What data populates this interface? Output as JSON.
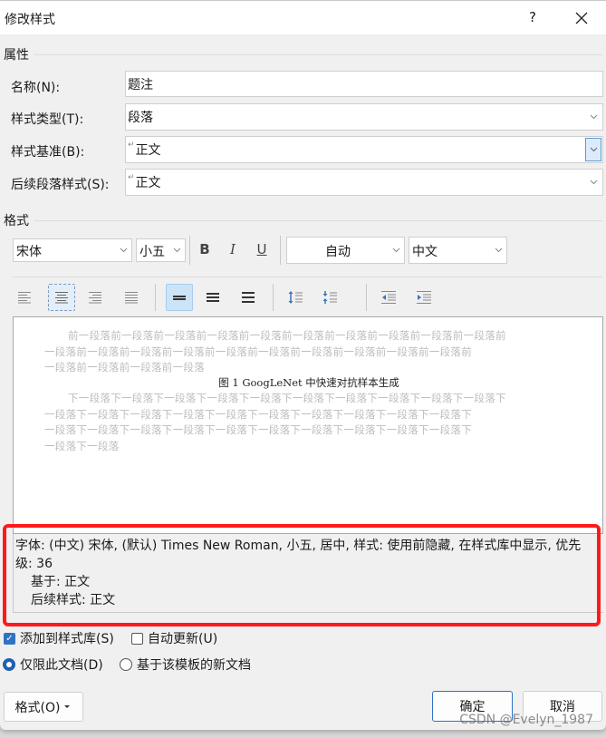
{
  "window": {
    "title": "修改样式",
    "help_label": "?",
    "close_label": "close"
  },
  "properties": {
    "section_label": "属性",
    "name": {
      "label": "名称(N):",
      "value": "题注"
    },
    "style_type": {
      "label": "样式类型(T):",
      "value": "段落"
    },
    "style_based_on": {
      "label": "样式基准(B):",
      "value": "正文",
      "para_mark": "↵"
    },
    "next_style": {
      "label": "后续段落样式(S):",
      "value": "正文",
      "para_mark": "↵"
    }
  },
  "format": {
    "section_label": "格式",
    "font": "宋体",
    "size": "小五",
    "bold_label": "B",
    "italic_label": "I",
    "underline_label": "U",
    "color": "自动",
    "script": "中文",
    "alignment_buttons": [
      "align-left",
      "align-center",
      "align-right",
      "align-justify"
    ],
    "selected_alignment": "align-center",
    "line_spacing_buttons": [
      "single",
      "one-and-half",
      "double"
    ],
    "selected_line_spacing": "single",
    "paragraph_spacing_buttons": [
      "increase-spacing",
      "decrease-spacing"
    ],
    "indent_buttons": [
      "decrease-indent",
      "increase-indent"
    ]
  },
  "preview": {
    "previous_lines": [
      "前一段落前一段落前一段落前一段落前一段落前一段落前一段落前一段落前一段落前一段落前",
      "一段落前一段落前一段落前一段落前一段落前一段落前一段落前一段落前一段落前一段落前",
      "一段落前一段落前一段落前一段落"
    ],
    "caption": "图 1 GoogLeNet 中快速对抗样本生成",
    "next_lines": [
      "下一段落下一段落下一段落下一段落下一段落下一段落下一段落下一段落下一段落下一段落下",
      "一段落下一段落下一段落下一段落下一段落下一段落下一段落下一段落下一段落下一段落下",
      "一段落下一段落下一段落下一段落下一段落下一段落下一段落下一段落下一段落下一段落下",
      "一段落下一段落"
    ]
  },
  "description": {
    "line1": "字体: (中文) 宋体, (默认) Times New Roman, 小五, 居中, 样式: 使用前隐藏, 在样式库中显示, 优先",
    "line2": "级: 36",
    "line3": "基于: 正文",
    "line4": "后续样式: 正文"
  },
  "options": {
    "add_to_gallery": {
      "label": "添加到样式库(S)",
      "checked": true
    },
    "auto_update": {
      "label": "自动更新(U)",
      "checked": false
    },
    "only_this_document": {
      "label": "仅限此文档(D)",
      "selected": true
    },
    "new_docs_template": {
      "label": "基于该模板的新文档",
      "selected": false
    }
  },
  "buttons": {
    "format_menu": "格式(O)",
    "ok": "确定",
    "cancel": "取消"
  },
  "watermark": "CSDN @Evelyn_1987",
  "colors": {
    "highlight_border": "#ff1a1a",
    "accent": "#2f73c4",
    "selected_bg": "#cce4f7"
  }
}
